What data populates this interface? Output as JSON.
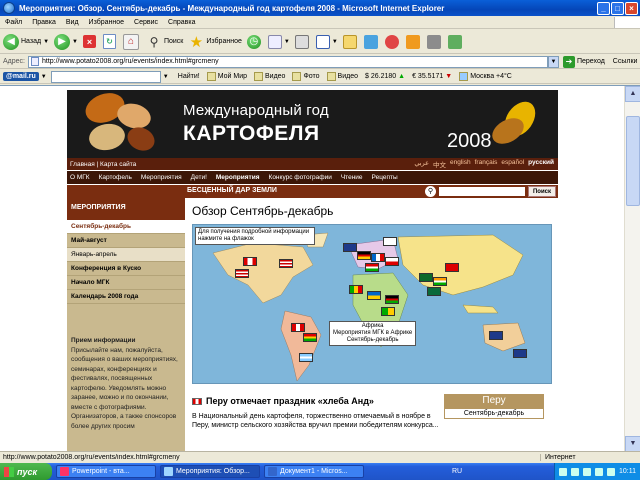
{
  "window": {
    "title": "Мероприятия: Обзор. Сентябрь-декабрь - Международный год картофеля 2008 - Microsoft Internet Explorer",
    "min": "_",
    "max": "□",
    "close": "×"
  },
  "menu": [
    "Файл",
    "Правка",
    "Вид",
    "Избранное",
    "Сервис",
    "Справка"
  ],
  "toolbar": {
    "back": "Назад",
    "search": "Поиск",
    "favorites": "Избранное"
  },
  "address": {
    "label": "Адрес:",
    "url": "http://www.potato2008.org/ru/events/index.html#grcmeny",
    "go": "Переход",
    "links": "Ссылки"
  },
  "mailru": {
    "logo": "@mail.ru",
    "items": [
      "Найти!",
      "Мой Мир",
      "Видео",
      "Фото",
      "Видео",
      "$ 26.2180",
      "€ 35.5171",
      "Москва +4°C"
    ]
  },
  "site": {
    "banner": {
      "line1": "Международный год",
      "line2": "КАРТОФЕЛЯ",
      "year": "2008"
    },
    "topnav_left": "Главная | Карта сайта",
    "languages": [
      "عربي",
      "中文",
      "english",
      "français",
      "español",
      "русский"
    ],
    "current_language": "русский",
    "mainnav": [
      "О МГК",
      "Картофель",
      "Мероприятия",
      "Дети!",
      "Мероприятия",
      "Конкурс фотографии",
      "Чтение",
      "Рецепты"
    ],
    "mainnav_current": 4,
    "tagline": "БЕСЦЕННЫЙ ДАР ЗЕМЛИ",
    "search_btn": "Поиск",
    "side": {
      "heading": "МЕРОПРИЯТИЯ",
      "items": [
        {
          "label": "Сентябрь-декабрь",
          "state": "cur"
        },
        {
          "label": "Май-август",
          "state": "bold"
        },
        {
          "label": "Январь-апрель",
          "state": "hi"
        },
        {
          "label": "Конференция в Куско",
          "state": "bold"
        },
        {
          "label": "Начало МГК",
          "state": "bold"
        },
        {
          "label": "Календарь 2008 года",
          "state": "bold"
        }
      ],
      "info_title": "Прием информации",
      "info_text": "Присылайте нам, пожалуйста, сообщения о ваших мероприятиях, семинарах, конференциях и фестивалях, посвященных картофелю. Уведомлять можно заранее, можно и по окончании, вместе с фотографиями. Организаторов, а также спонсоров более других просим"
    },
    "content": {
      "title": "Обзор  Сентябрь-декабрь",
      "map_tip": "Для получения подробной информации нажмите на флажок",
      "map_tooltip": [
        "Африка",
        "Мероприятия МГК в Африке",
        "Сентябрь-декабрь"
      ],
      "news_title": "Перу отмечает праздник «хлеба Анд»",
      "peru_label": "Перу",
      "peru_sub": "Сентябрь-декабрь",
      "body": "В Национальный день картофеля, торжественно отмечаемый в ноябре в Перу, министр сельского хозяйства вручил премии победителям конкурса..."
    }
  },
  "status": {
    "url": "http://www.potato2008.org/ru/events/index.html#grcmeny",
    "zone": "Интернет"
  },
  "taskbar": {
    "start": "пуск",
    "tasks": [
      "Powerpoint - вта...",
      "Мероприятия: Обзор...",
      "Документ1 - Micros..."
    ],
    "active_task": 1,
    "lang": "RU",
    "clock": "10:11"
  }
}
